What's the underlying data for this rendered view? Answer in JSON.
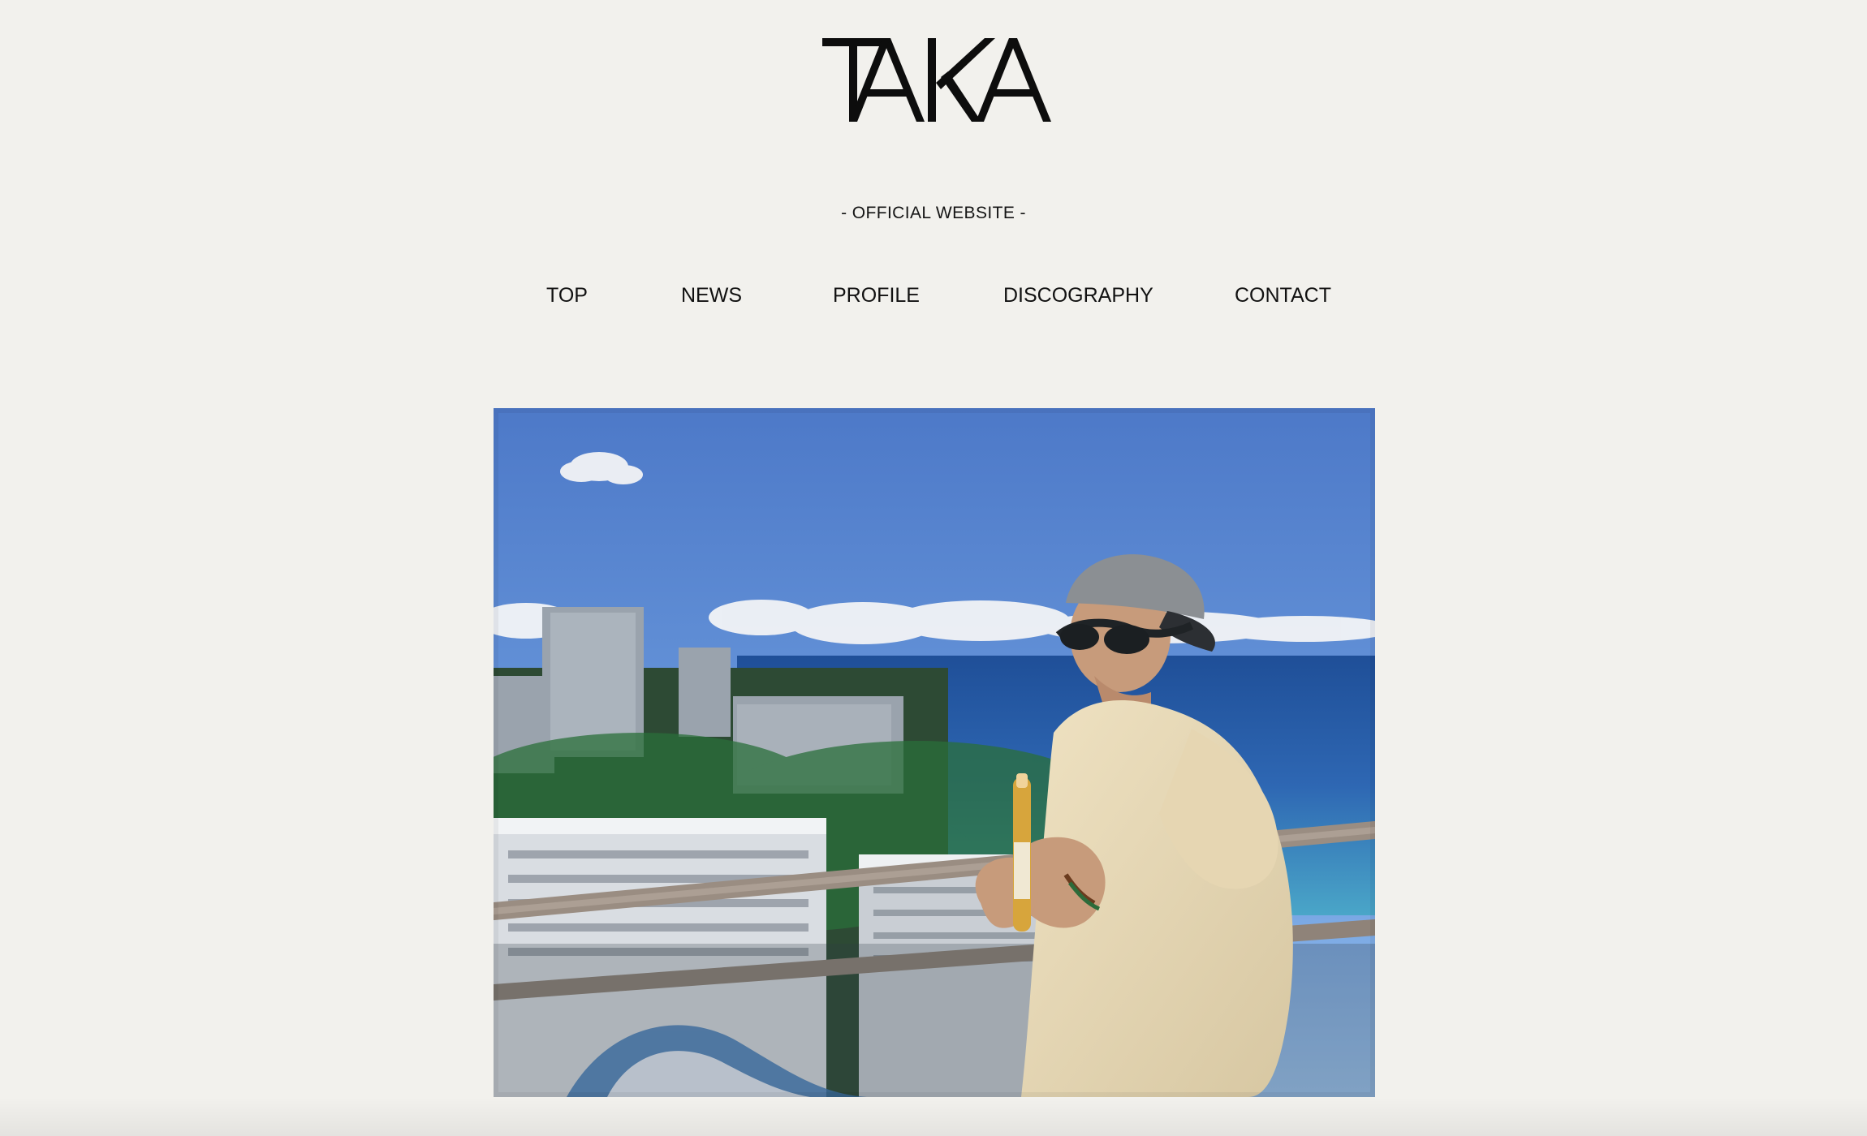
{
  "site": {
    "logo_text": "TAKA",
    "tagline": "- OFFICIAL WEBSITE -"
  },
  "nav": {
    "items": [
      {
        "label": "TOP"
      },
      {
        "label": "NEWS"
      },
      {
        "label": "PROFILE"
      },
      {
        "label": "DISCOGRAPHY"
      },
      {
        "label": "CONTACT"
      }
    ]
  },
  "hero": {
    "image_icon": "photo-icon"
  },
  "colors": {
    "background": "#f2f1ed",
    "text": "#111111",
    "sky": "#4a76c4",
    "ocean": "#2f66b0"
  }
}
